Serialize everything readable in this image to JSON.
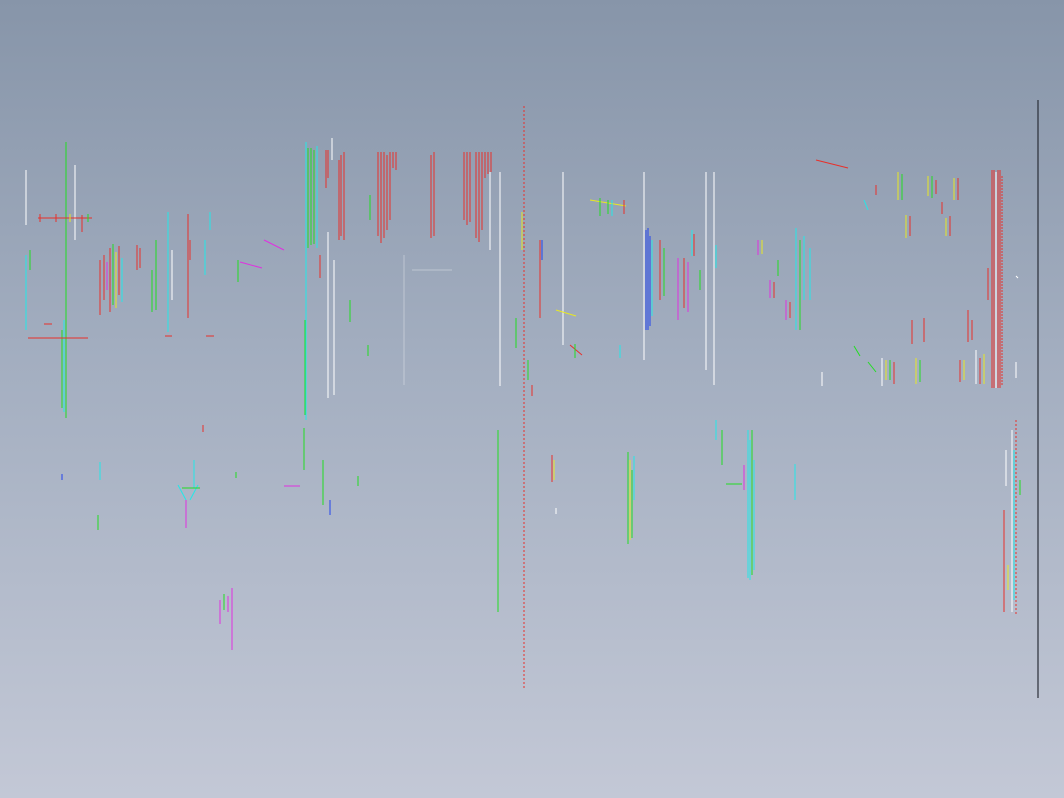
{
  "viewport": {
    "background_top": "#8795a9",
    "background_bottom": "#c3c8d6"
  },
  "palette": {
    "red": "#e8302a",
    "green": "#22dd22",
    "cyan": "#22e8e8",
    "white": "#ffffff",
    "yellow": "#e8e822",
    "magenta": "#e030e0",
    "blue": "#2244ee",
    "dark": "#2a2e38"
  }
}
